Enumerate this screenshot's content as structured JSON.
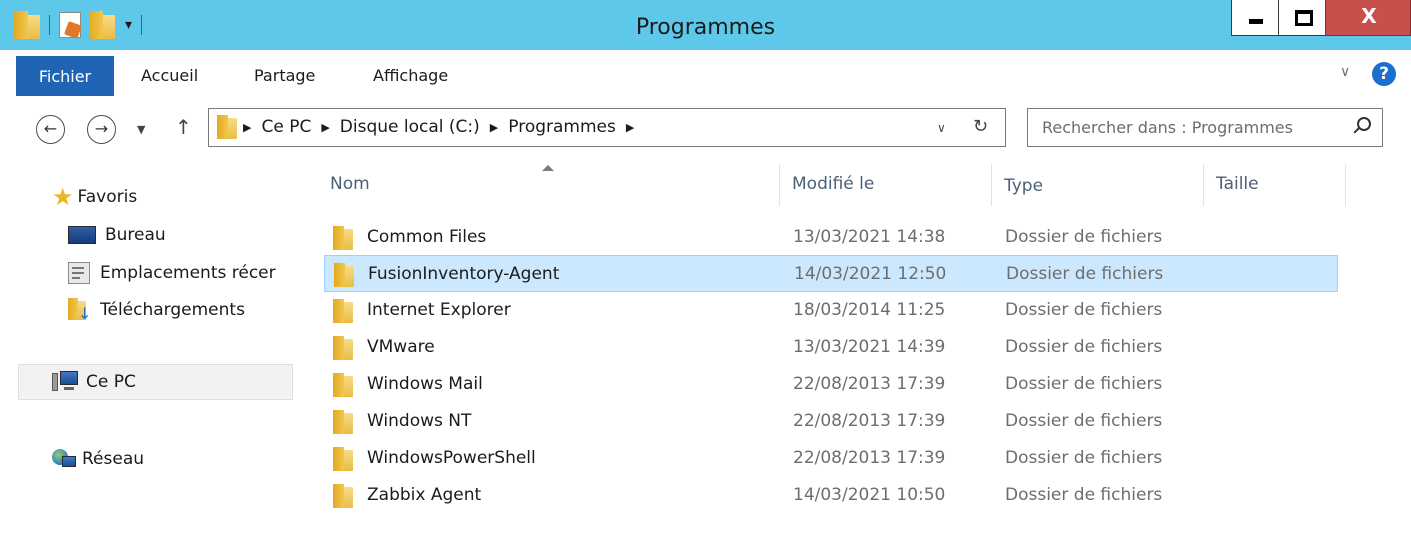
{
  "window": {
    "title": "Programmes",
    "close_label": "X"
  },
  "ribbon": {
    "tabs": [
      "Fichier",
      "Accueil",
      "Partage",
      "Affichage"
    ],
    "help_label": "?"
  },
  "address": {
    "crumbs": [
      "Ce PC",
      "Disque local (C:)",
      "Programmes"
    ]
  },
  "search": {
    "placeholder": "Rechercher dans : Programmes"
  },
  "navpane": {
    "favorites": "Favoris",
    "favorite_items": [
      "Bureau",
      "Emplacements récer",
      "Téléchargements"
    ],
    "this_pc": "Ce PC",
    "network": "Réseau"
  },
  "columns": {
    "name": "Nom",
    "modified": "Modifié le",
    "type": "Type",
    "size": "Taille"
  },
  "files": [
    {
      "name": "Common Files",
      "modified": "13/03/2021 14:38",
      "type": "Dossier de fichiers",
      "size": ""
    },
    {
      "name": "FusionInventory-Agent",
      "modified": "14/03/2021 12:50",
      "type": "Dossier de fichiers",
      "size": "",
      "selected": true
    },
    {
      "name": "Internet Explorer",
      "modified": "18/03/2014 11:25",
      "type": "Dossier de fichiers",
      "size": ""
    },
    {
      "name": "VMware",
      "modified": "13/03/2021 14:39",
      "type": "Dossier de fichiers",
      "size": ""
    },
    {
      "name": "Windows Mail",
      "modified": "22/08/2013 17:39",
      "type": "Dossier de fichiers",
      "size": ""
    },
    {
      "name": "Windows NT",
      "modified": "22/08/2013 17:39",
      "type": "Dossier de fichiers",
      "size": ""
    },
    {
      "name": "WindowsPowerShell",
      "modified": "22/08/2013 17:39",
      "type": "Dossier de fichiers",
      "size": ""
    },
    {
      "name": "Zabbix Agent",
      "modified": "14/03/2021 10:50",
      "type": "Dossier de fichiers",
      "size": ""
    }
  ],
  "colors": {
    "titlebar": "#5ec8ea",
    "file_tab": "#1f64b5",
    "selection": "#cce8ff",
    "close_button": "#c7504a"
  }
}
